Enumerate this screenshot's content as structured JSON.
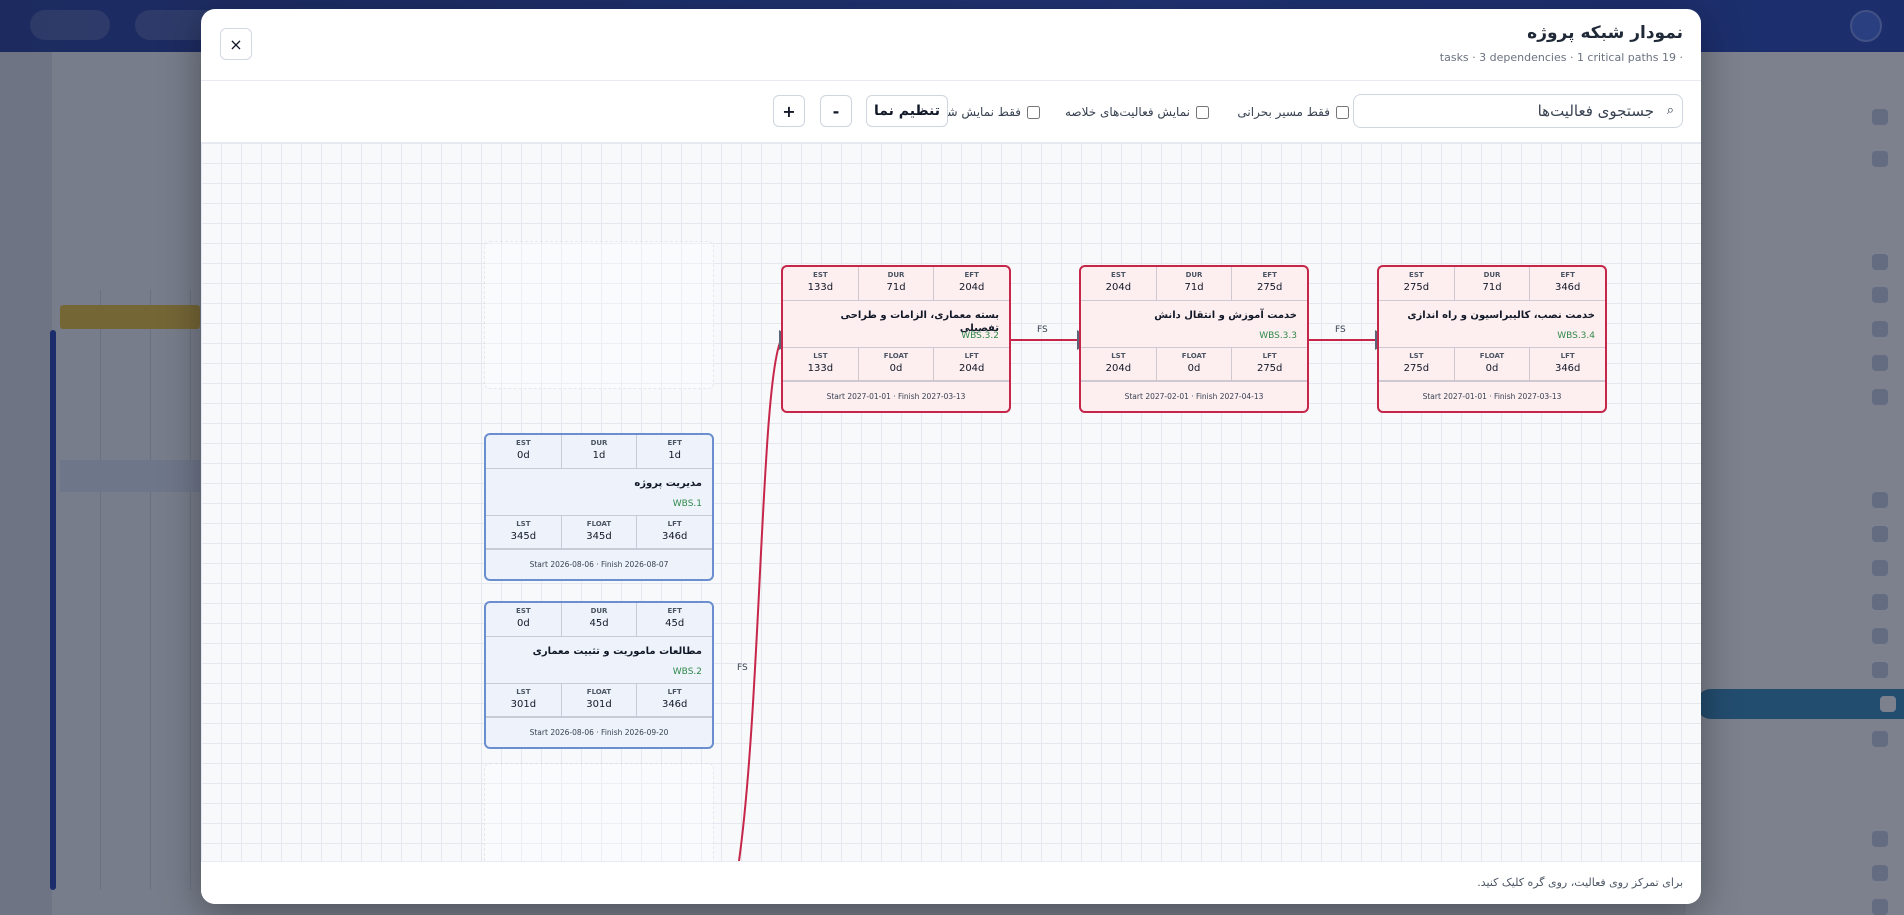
{
  "modal": {
    "title": "نمودار شبکه پروژه",
    "meta": "tasks · 3 dependencies · 1 critical paths 19 ·",
    "close_label": "×"
  },
  "toolbar": {
    "search_placeholder": "جستجوی فعالیت‌ها",
    "search_icon": "⌕",
    "critical_only_label": "فقط مسیر بحرانی",
    "show_summary_label": "نمایش فعالیت‌های خلاصه",
    "ids_only_label": "فقط نمایش شناسه",
    "fit_label": "تنظیم نما",
    "zoom_out_label": "-",
    "zoom_in_label": "+"
  },
  "labels": {
    "est": "EST",
    "dur": "DUR",
    "eft": "EFT",
    "lst": "LST",
    "float": "FLOAT",
    "lft": "LFT"
  },
  "nodes": [
    {
      "name": "بسته معماری، الزامات و طراحی تفصیلی",
      "wbs": "WBS.3.2",
      "est": "133d",
      "dur": "71d",
      "eft": "204d",
      "lst": "133d",
      "float": "0d",
      "lft": "204d",
      "dates": "Start 2027-01-01 · Finish 2027-03-13"
    },
    {
      "name": "خدمت آموزش و انتقال دانش",
      "wbs": "WBS.3.3",
      "est": "204d",
      "dur": "71d",
      "eft": "275d",
      "lst": "204d",
      "float": "0d",
      "lft": "275d",
      "dates": "Start 2027-02-01 · Finish 2027-04-13"
    },
    {
      "name": "خدمت نصب، کالیبراسیون و راه اندازی",
      "wbs": "WBS.3.4",
      "est": "275d",
      "dur": "71d",
      "eft": "346d",
      "lst": "275d",
      "float": "0d",
      "lft": "346d",
      "dates": "Start 2027-01-01 · Finish 2027-03-13"
    },
    {
      "name": "مدیریت پروژه",
      "wbs": "WBS.1",
      "est": "0d",
      "dur": "1d",
      "eft": "1d",
      "lst": "345d",
      "float": "345d",
      "lft": "346d",
      "dates": "Start 2026-08-06 · Finish 2026-08-07"
    },
    {
      "name": "مطالعات ماموریت و تثبیت معماری",
      "wbs": "WBS.2",
      "est": "0d",
      "dur": "45d",
      "eft": "45d",
      "lst": "301d",
      "float": "301d",
      "lft": "346d",
      "dates": "Start 2026-08-06 · Finish 2026-09-20"
    }
  ],
  "edges": [
    "FS",
    "FS",
    "FS"
  ],
  "footer": {
    "hint": "برای تمرکز روی فعالیت، روی گره کلیک کنید."
  },
  "colors": {
    "critical": "#c6264a",
    "normal": "#6b8fce",
    "arrow": "#5b6475"
  }
}
